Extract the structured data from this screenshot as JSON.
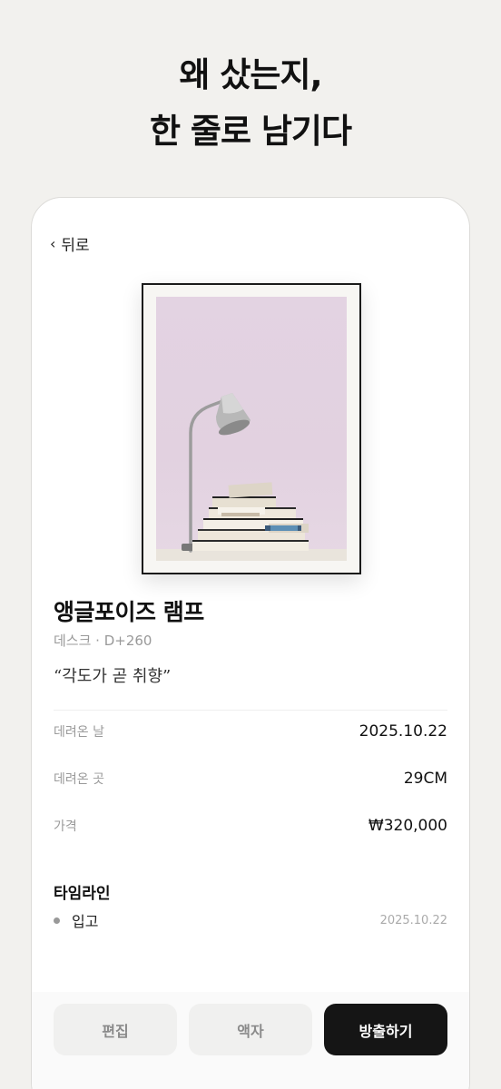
{
  "headline": {
    "line1": "왜 샀는지,",
    "line2": "한 줄로 남기다"
  },
  "nav": {
    "back_icon": "chevron-left-icon",
    "back_label": "뒤로"
  },
  "item": {
    "name": "앵글포이즈 램프",
    "meta": "데스크 · D+260",
    "quote": "“각도가 곧 취향”"
  },
  "details": [
    {
      "label": "데려온 날",
      "value": "2025.10.22"
    },
    {
      "label": "데려온 곳",
      "value": "29CM"
    },
    {
      "label": "가격",
      "value": "₩320,000"
    }
  ],
  "timeline": {
    "title": "타임라인",
    "items": [
      {
        "label": "입고",
        "date": "2025.10.22"
      }
    ]
  },
  "actions": {
    "edit": "편집",
    "frame": "액자",
    "release": "방출하기"
  },
  "colors": {
    "background": "#f2f1ee",
    "primary_button": "#151515",
    "photo_wall": "#e3d3e2"
  }
}
